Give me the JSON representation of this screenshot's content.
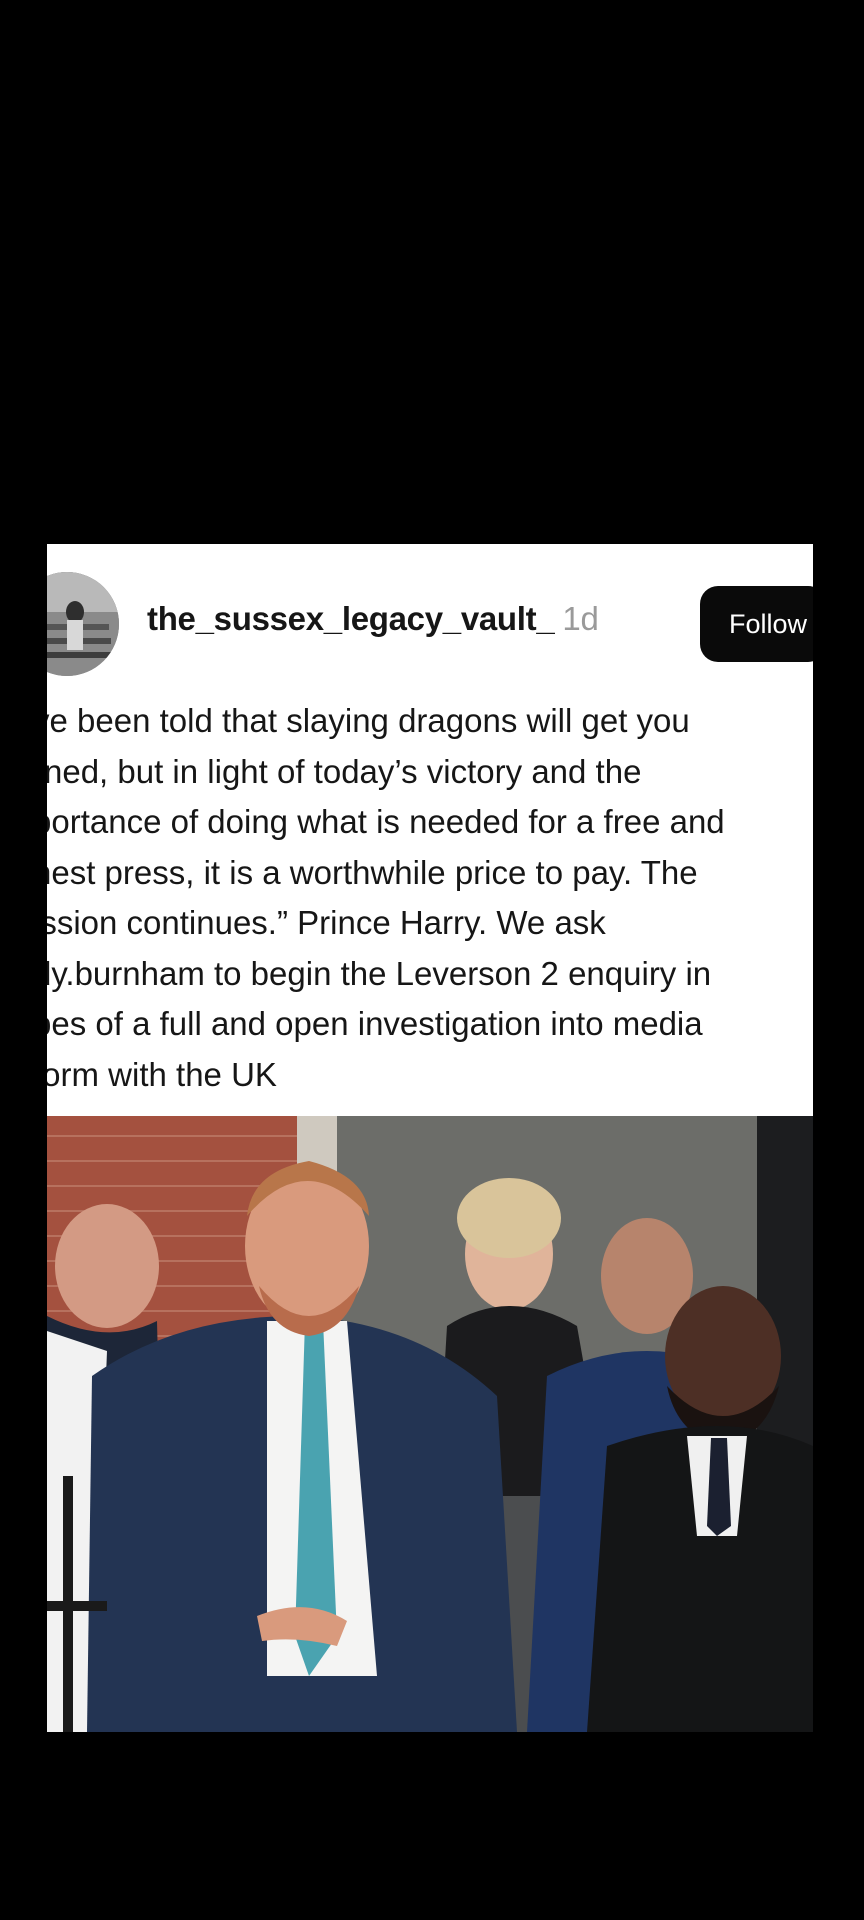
{
  "post": {
    "username": "the_sussex_legacy_vault_",
    "timestamp": "1d",
    "follow_label": "Follow",
    "caption_lines": [
      "ve been told that slaying dragons will get you",
      "rned, but in light of today’s victory and the",
      "portance of doing what is needed for a free and",
      "nest press, it is a worthwhile price to pay. The",
      "ission continues.” Prince Harry. We ask",
      "dy.burnham to begin the Leverson 2 enquiry in",
      "pes of a full and open investigation into media",
      "form with the UK"
    ]
  },
  "colors": {
    "background": "#000000",
    "card": "#ffffff",
    "follow_button": "#0a0a0a",
    "timestamp": "#9a9a9a"
  },
  "icons": {
    "avatar": "profile-photo"
  }
}
